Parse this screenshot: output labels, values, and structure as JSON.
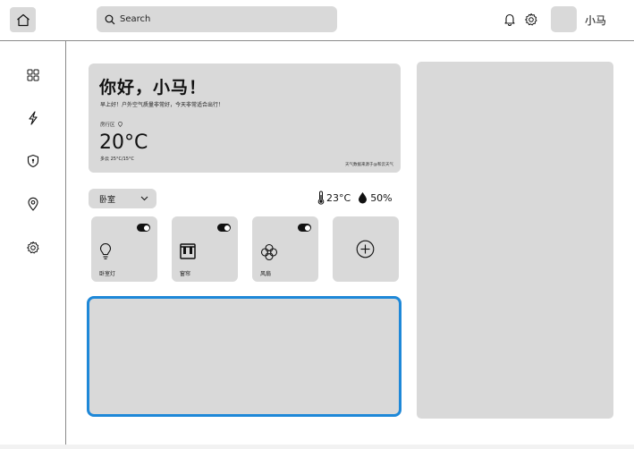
{
  "header": {
    "search_placeholder": "Search",
    "username": "小马"
  },
  "sidebar": {
    "items": [
      {
        "icon": "grid-icon"
      },
      {
        "icon": "lightning-icon"
      },
      {
        "icon": "shield-icon"
      },
      {
        "icon": "location-pin-icon"
      },
      {
        "icon": "gear-icon"
      }
    ]
  },
  "weather": {
    "greeting": "你好，小马！",
    "subtitle": "早上好！户外空气质量非常好，今天非常适合出行！",
    "district": "房行区",
    "temperature": "20°C",
    "condition": "多云  25°C/15°C",
    "source": "天气数据来源于@和云天气"
  },
  "room": {
    "selected": "卧室",
    "indoor_temp": "23°C",
    "indoor_humidity": "50%"
  },
  "devices": [
    {
      "name": "卧室灯",
      "icon": "lightbulb-icon",
      "on": true
    },
    {
      "name": "窗帘",
      "icon": "curtain-icon",
      "on": true
    },
    {
      "name": "风扇",
      "icon": "fan-icon",
      "on": true
    }
  ],
  "colors": {
    "accent": "#1e88d8",
    "card": "#d9d9d9",
    "divider": "#8a8a8a"
  }
}
